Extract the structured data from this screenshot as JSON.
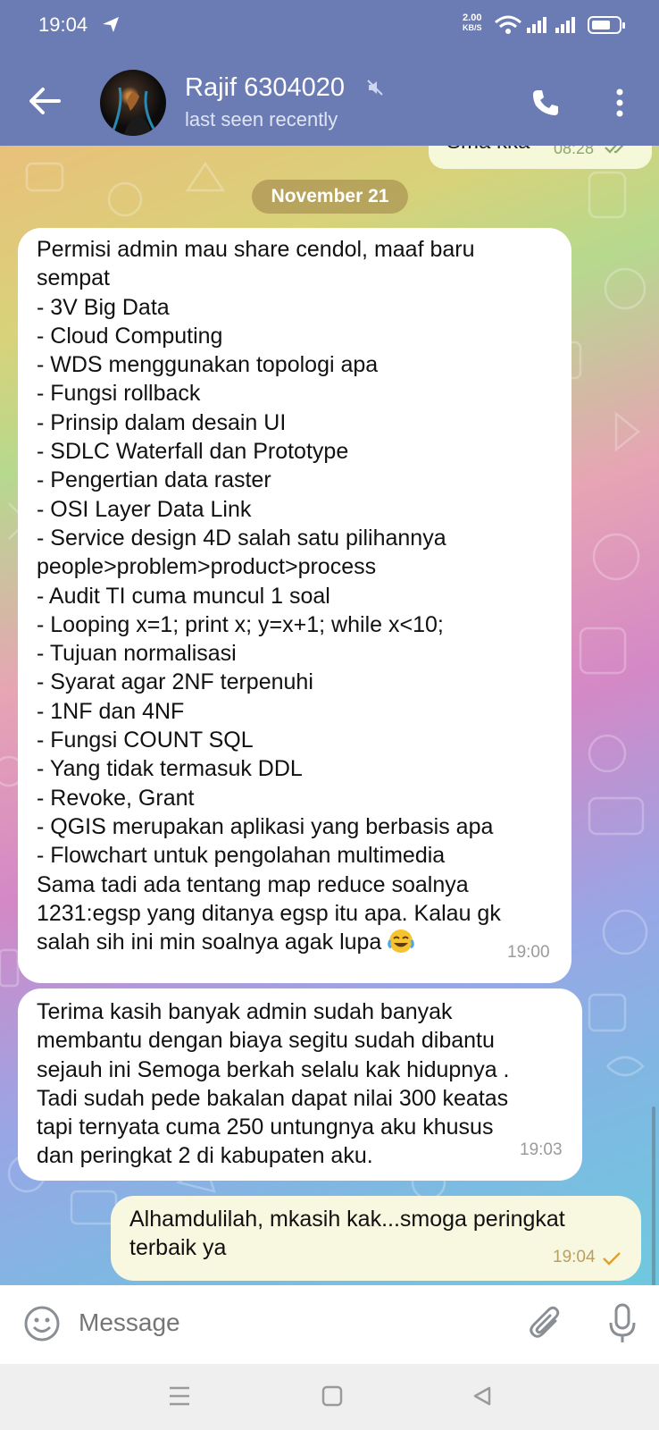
{
  "status_bar": {
    "time": "19:04",
    "speed_value": "2.00",
    "speed_unit": "KB/S",
    "battery_percent": 70
  },
  "header": {
    "title": "Rajif 6304020",
    "subtitle": "last seen recently",
    "icons": [
      "back-arrow-icon",
      "muted-icon",
      "phone-icon",
      "more-vertical-icon"
    ]
  },
  "chat": {
    "top_partial": {
      "text": "Sma kka",
      "time": "08:28",
      "status": "read"
    },
    "date_chip": "November 21",
    "messages": [
      {
        "direction": "incoming",
        "lines": [
          "Permisi admin mau share cendol, maaf baru",
          "sempat",
          "- 3V Big Data",
          "- Cloud Computing",
          "- WDS menggunakan topologi apa",
          "- Fungsi rollback",
          "- Prinsip dalam desain UI",
          "- SDLC Waterfall dan Prototype",
          "- Pengertian data raster",
          "- OSI Layer Data Link",
          "- Service design 4D salah satu pilihannya",
          "people>problem>product>process",
          "- Audit TI cuma muncul 1 soal",
          "- Looping x=1; print x; y=x+1; while x<10;",
          "- Tujuan normalisasi",
          "- Syarat agar 2NF terpenuhi",
          "- 1NF dan 4NF",
          "- Fungsi COUNT SQL",
          "- Yang tidak termasuk DDL",
          "- Revoke, Grant",
          "- QGIS merupakan aplikasi yang berbasis apa",
          "- Flowchart untuk pengolahan multimedia",
          "Sama tadi ada tentang map reduce soalnya",
          "1231:egsp yang ditanya egsp itu apa. Kalau gk",
          "salah sih ini min soalnya agak lupa"
        ],
        "emoji": "tears-of-joy-emoji",
        "time": "19:00"
      },
      {
        "direction": "incoming",
        "lines": [
          "Terima kasih banyak admin sudah banyak",
          "membantu dengan biaya segitu sudah dibantu",
          "sejauh ini Semoga berkah selalu kak hidupnya .",
          "Tadi sudah pede bakalan dapat nilai 300 keatas",
          "tapi ternyata cuma 250 untungnya aku khusus",
          "dan peringkat 2 di kabupaten aku."
        ],
        "time": "19:03"
      },
      {
        "direction": "outgoing",
        "lines": [
          "Alhamdulilah, mkasih kak...smoga peringkat",
          "terbaik ya"
        ],
        "time": "19:04",
        "status": "sent"
      }
    ]
  },
  "composer": {
    "placeholder": "Message",
    "icons": [
      "emoji-icon",
      "attach-icon",
      "microphone-icon"
    ]
  },
  "nav_bar": {
    "icons": [
      "menu-nav-icon",
      "home-nav-icon",
      "back-nav-icon"
    ]
  },
  "colors": {
    "header": "#6b7bb4",
    "incoming_bubble": "#ffffff",
    "outgoing_bubble": "#f8f7df",
    "outgoing_check": "#e0a030"
  }
}
